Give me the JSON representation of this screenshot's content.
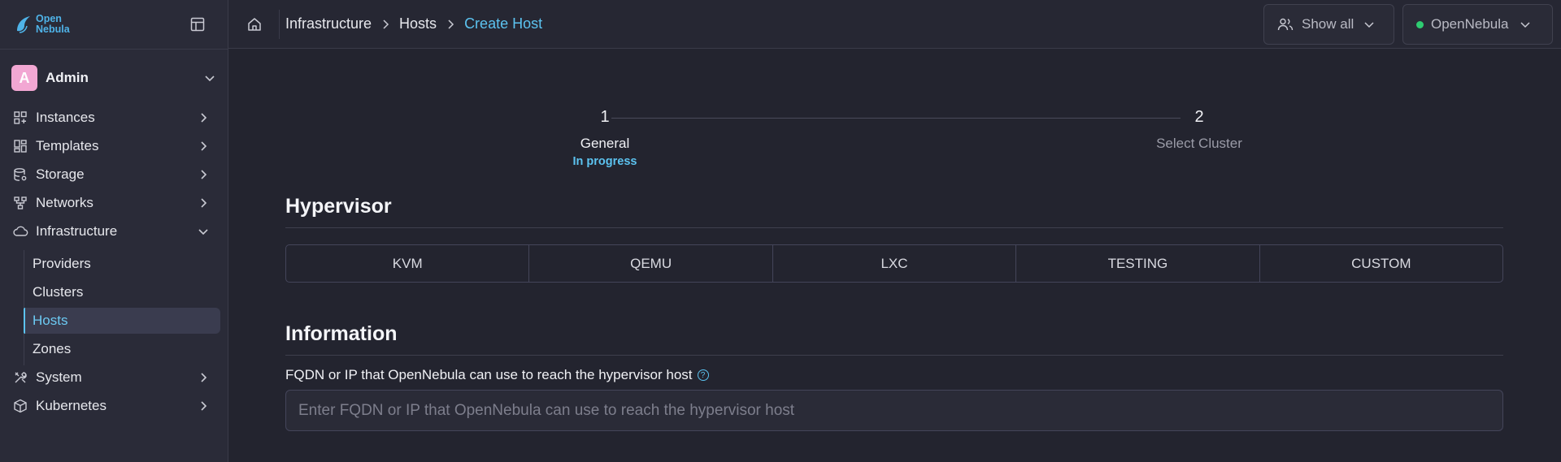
{
  "brand": {
    "line1": "Open",
    "line2": "Nebula",
    "color": "#4fb3e8"
  },
  "user": {
    "initial": "A",
    "name": "Admin"
  },
  "sidebar": {
    "items": [
      {
        "label": "Instances",
        "icon": "instances-icon"
      },
      {
        "label": "Templates",
        "icon": "templates-icon"
      },
      {
        "label": "Storage",
        "icon": "storage-icon"
      },
      {
        "label": "Networks",
        "icon": "networks-icon"
      },
      {
        "label": "Infrastructure",
        "icon": "cloud-icon"
      },
      {
        "label": "System",
        "icon": "tools-icon"
      },
      {
        "label": "Kubernetes",
        "icon": "cube-icon"
      }
    ],
    "infrastructure_sub": [
      {
        "label": "Providers"
      },
      {
        "label": "Clusters"
      },
      {
        "label": "Hosts",
        "active": true
      },
      {
        "label": "Zones"
      }
    ]
  },
  "breadcrumb": [
    {
      "label": "Infrastructure"
    },
    {
      "label": "Hosts"
    },
    {
      "label": "Create Host"
    }
  ],
  "topbar": {
    "filter_label": "Show all",
    "zone_label": "OpenNebula",
    "zone_status_color": "#2ecc71"
  },
  "stepper": {
    "steps": [
      {
        "number": "1",
        "title": "General",
        "status": "In progress"
      },
      {
        "number": "2",
        "title": "Select Cluster",
        "status": ""
      }
    ]
  },
  "hypervisor": {
    "title": "Hypervisor",
    "options": [
      "KVM",
      "QEMU",
      "LXC",
      "TESTING",
      "CUSTOM"
    ]
  },
  "information": {
    "title": "Information",
    "field_label": "FQDN or IP that OpenNebula can use to reach the hypervisor host",
    "field_placeholder": "Enter FQDN or IP that OpenNebula can use to reach the hypervisor host",
    "field_value": ""
  },
  "colors": {
    "accent": "#5cc3f0",
    "background": "#23242f",
    "sidebar": "#2a2b38",
    "avatar": "#f2a7d3"
  }
}
